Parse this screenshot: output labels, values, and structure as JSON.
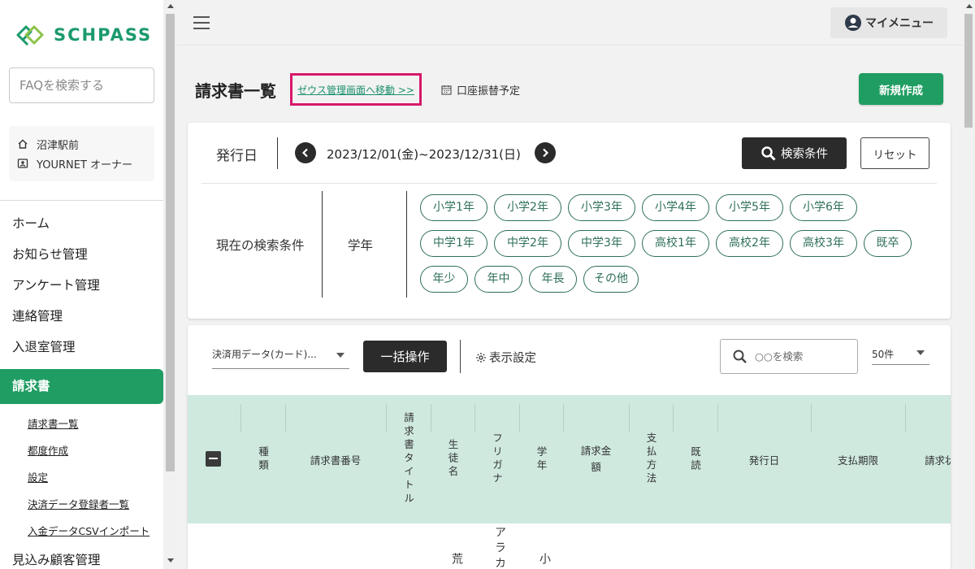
{
  "brand": {
    "logo_text": "SCHPASS",
    "accent": "#1f9d62"
  },
  "sidebar": {
    "faq_placeholder": "FAQを検索する",
    "school": "沼津駅前",
    "user": "YOURNET オーナー",
    "nav": [
      {
        "label": "ホーム"
      },
      {
        "label": "お知らせ管理"
      },
      {
        "label": "アンケート管理"
      },
      {
        "label": "連絡管理"
      },
      {
        "label": "入退室管理"
      }
    ],
    "active": "請求書",
    "subnav": [
      {
        "label": "請求書一覧"
      },
      {
        "label": "都度作成"
      },
      {
        "label": "設定"
      },
      {
        "label": "決済データ登録者一覧"
      },
      {
        "label": "入金データCSVインポート"
      }
    ],
    "bottom": "見込み顧客管理"
  },
  "topbar": {
    "mymenu_label": "マイメニュー"
  },
  "header": {
    "title": "請求書一覧",
    "zeus_link": "ゼウス管理画面へ移動 >>",
    "account_schedule": "口座振替予定",
    "new_button": "新規作成"
  },
  "filter": {
    "issue_label": "発行日",
    "date_range": "2023/12/01(金)~2023/12/31(日)",
    "search_button": "検索条件",
    "reset_button": "リセット",
    "current_label": "現在の検索条件",
    "grade_label": "学年",
    "chips": [
      "小学1年",
      "小学2年",
      "小学3年",
      "小学4年",
      "小学5年",
      "小学6年",
      "中学1年",
      "中学2年",
      "中学3年",
      "高校1年",
      "高校2年",
      "高校3年",
      "既卒",
      "年少",
      "年中",
      "年長",
      "その他"
    ]
  },
  "toolbar": {
    "select_value": "決済用データ(カード)...",
    "bulk_button": "一括操作",
    "display_settings": "表示設定",
    "search_placeholder": "○○を検索",
    "per_page": "50件"
  },
  "table": {
    "columns": [
      "種類",
      "請求書番号",
      "請求書タイトル",
      "生徒名",
      "フリガナ",
      "学年",
      "請求金額",
      "支払方法",
      "既読",
      "発行日",
      "支払期限",
      "請求状"
    ],
    "header_bg": "#cfe9df",
    "row1_partial": {
      "student": "荒",
      "furigana": "アラカ",
      "grade": "小"
    }
  }
}
